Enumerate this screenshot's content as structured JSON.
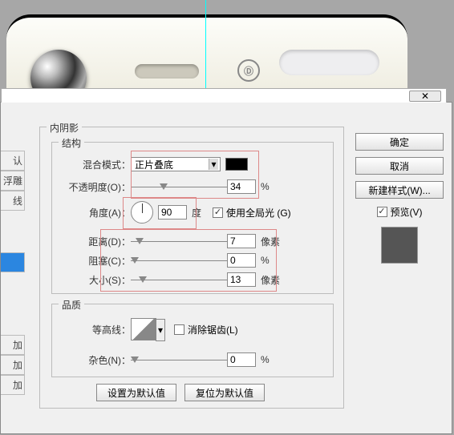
{
  "section_title": "内阴影",
  "structure": {
    "legend": "结构",
    "blend_label": "混合模式：",
    "blend_value": "正片叠底",
    "color": "#000000",
    "opacity_label": "不透明度(O)：",
    "opacity_value": "34",
    "opacity_unit": "%",
    "angle_label": "角度(A)：",
    "angle_value": "90",
    "angle_unit": "度",
    "global_light_label": "使用全局光 (G)",
    "global_light_checked": true,
    "distance_label": "距离(D)：",
    "distance_value": "7",
    "distance_unit": "像素",
    "choke_label": "阻塞(C)：",
    "choke_value": "0",
    "choke_unit": "%",
    "size_label": "大小(S)：",
    "size_value": "13",
    "size_unit": "像素"
  },
  "quality": {
    "legend": "品质",
    "contour_label": "等高线：",
    "anti_alias_label": "消除锯齿(L)",
    "anti_alias_checked": false,
    "noise_label": "杂色(N)：",
    "noise_value": "0",
    "noise_unit": "%"
  },
  "bottom": {
    "default": "设置为默认值",
    "reset": "复位为默认值"
  },
  "right": {
    "ok": "确定",
    "cancel": "取消",
    "new_style": "新建样式(W)...",
    "preview": "预览(V)"
  },
  "left_tabs": {
    "t1": "认",
    "t2": "浮雕",
    "t3": "线",
    "t4": "加",
    "t5": "加",
    "t6": "加"
  },
  "close_glyph": "✕",
  "device_icon": "①"
}
